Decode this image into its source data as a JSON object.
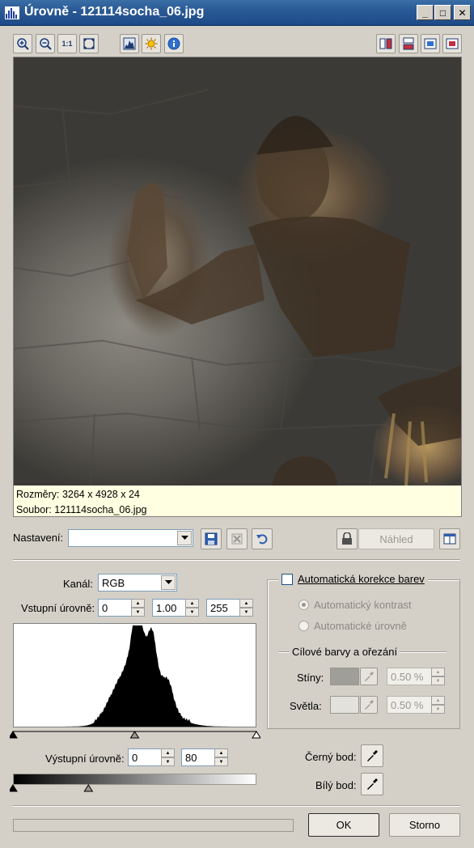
{
  "window": {
    "title": "Úrovně - 121114socha_06.jpg",
    "minimize_glyph": "_",
    "maximize_glyph": "□",
    "close_glyph": "✕"
  },
  "toolbar": {
    "left_icons": [
      "zoom-in-icon",
      "zoom-out-icon",
      "actual-size-icon",
      "fit-to-window-icon"
    ],
    "middle_icons": [
      "histogram-icon",
      "sun-icon",
      "info-icon"
    ],
    "right_icons": [
      "split-vertical-icon",
      "split-horizontal-icon",
      "single-view-icon",
      "original-view-icon"
    ],
    "actual_size_label": "1:1"
  },
  "image_info": {
    "dimensions": "Rozměry: 3264 x 4928 x 24",
    "file": "Soubor: 121114socha_06.jpg"
  },
  "presets": {
    "label": "Nastavení:",
    "value": "",
    "preview_button": "Náhled"
  },
  "levels": {
    "channel_label": "Kanál:",
    "channel_value": "RGB",
    "input_label": "Vstupní úrovně:",
    "input_black": "0",
    "input_gamma": "1.00",
    "input_white": "255",
    "output_label": "Výstupní úrovně:",
    "output_black": "0",
    "output_white": "80",
    "input_marker_positions": [
      0,
      0.5,
      1
    ],
    "output_marker_positions": [
      0,
      0.31
    ]
  },
  "auto_correction": {
    "checkbox_label": "Automatická korekce barev",
    "checked": false,
    "auto_contrast": "Automatický kontrast",
    "auto_levels": "Automatické úrovně",
    "target_group_label": "Cílové barvy a ořezání",
    "shadows_label": "Stíny:",
    "shadows_value": "0.50 %",
    "highlights_label": "Světla:",
    "highlights_value": "0.50 %",
    "shadows_color": "#a09e98",
    "highlights_color": "#e3e1db"
  },
  "points": {
    "black_label": "Černý bod:",
    "white_label": "Bílý bod:"
  },
  "footer": {
    "ok": "OK",
    "cancel": "Storno",
    "progress": 0
  },
  "colors": {
    "window_bg": "#d4d0c8",
    "title_bar": "#2a5a96",
    "info_bg": "#ffffe1"
  }
}
